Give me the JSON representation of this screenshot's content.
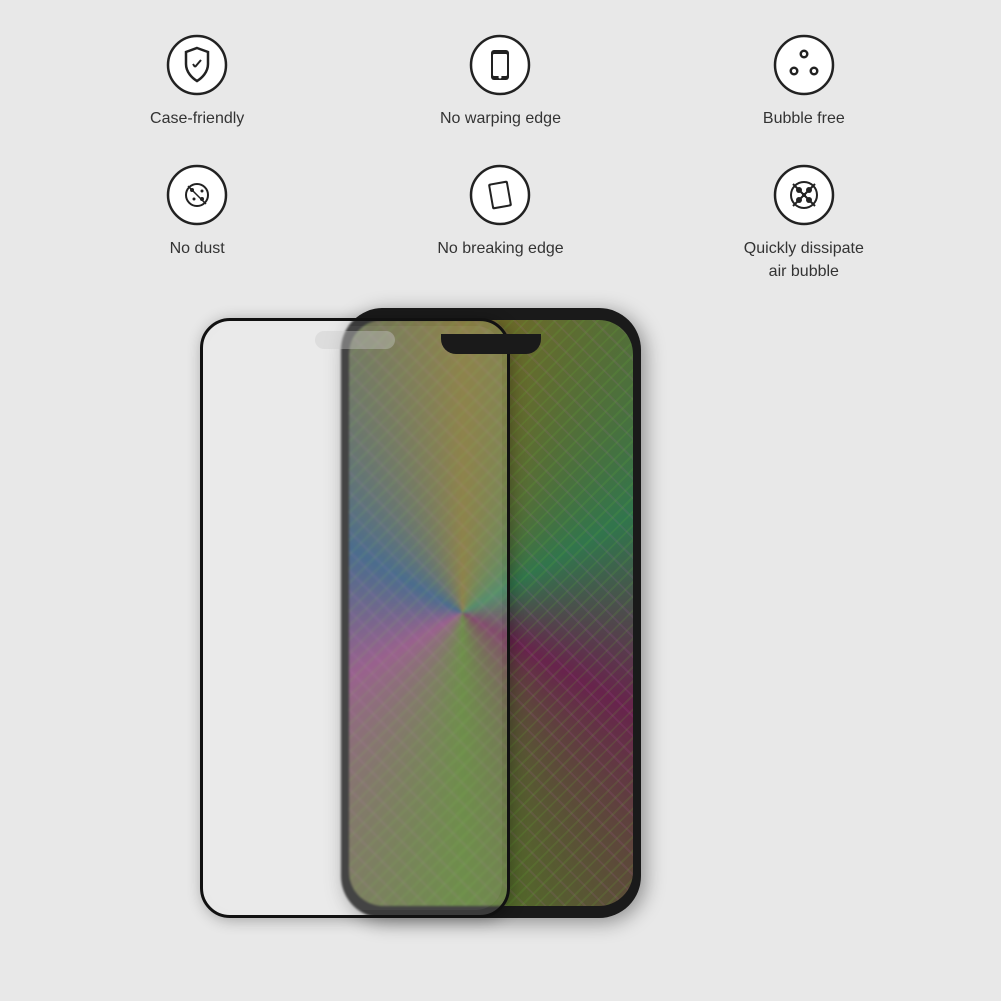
{
  "features": [
    {
      "id": "case-friendly",
      "label": "Case-friendly",
      "icon": "case-friendly-icon"
    },
    {
      "id": "no-warping-edge",
      "label": "No warping edge",
      "icon": "no-warping-icon"
    },
    {
      "id": "bubble-free",
      "label": "Bubble free",
      "icon": "bubble-free-icon"
    },
    {
      "id": "no-dust",
      "label": "No dust",
      "icon": "no-dust-icon"
    },
    {
      "id": "no-breaking-edge",
      "label": "No breaking edge",
      "icon": "no-breaking-icon"
    },
    {
      "id": "quickly-dissipate",
      "label": "Quickly dissipate\nair bubble",
      "icon": "dissipate-icon"
    }
  ],
  "product": {
    "description": "Screen protector shown with iPhone"
  }
}
